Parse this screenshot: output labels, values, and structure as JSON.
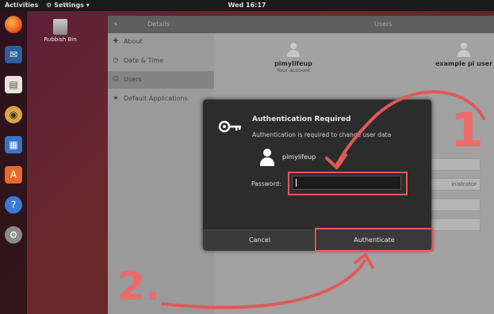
{
  "topbar": {
    "activities": "Activities",
    "app_menu": "Settings",
    "clock": "Wed 16:17"
  },
  "desktop": {
    "trash_label": "Rubbish Bin"
  },
  "settings": {
    "header_title": "Details",
    "header_users": "Users",
    "sidebar": [
      {
        "label": "About",
        "icon": "plus-icon"
      },
      {
        "label": "Date & Time",
        "icon": "clock-icon"
      },
      {
        "label": "Users",
        "icon": "users-icon"
      },
      {
        "label": "Default Applications",
        "icon": "star-icon"
      }
    ],
    "users": [
      {
        "name": "pimylifeup",
        "subtitle": "Your account"
      },
      {
        "name": "example pi user",
        "subtitle": ""
      }
    ],
    "bg_field_text": "inistrator"
  },
  "dialog": {
    "title": "Authentication Required",
    "message": "Authentication is required to change user data",
    "username": "pimylifeup",
    "password_label": "Password:",
    "password_value": "",
    "cancel_label": "Cancel",
    "authenticate_label": "Authenticate"
  },
  "annotations": {
    "step1": "1",
    "step2": "2.",
    "color": "#e05a5a"
  }
}
